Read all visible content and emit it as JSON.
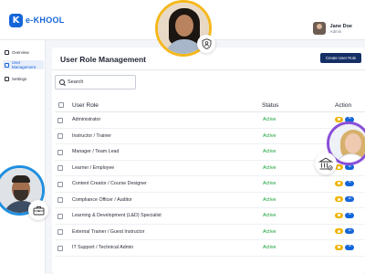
{
  "brand": {
    "logo_mark": "K",
    "name": "e-KHOOL",
    "color": "#1466d8"
  },
  "user": {
    "name": "Jane Doe",
    "role": "Admin"
  },
  "sidebar": {
    "items": [
      {
        "label": "Overview",
        "icon": "overview-icon",
        "active": false
      },
      {
        "label": "User Management",
        "icon": "users-icon",
        "active": true
      },
      {
        "label": "Settings",
        "icon": "settings-icon",
        "active": false
      }
    ]
  },
  "page": {
    "title": "User Role Management",
    "create_button": "Create User Role"
  },
  "search": {
    "placeholder": "Search"
  },
  "table": {
    "columns": [
      "User Role",
      "Status",
      "Action"
    ],
    "rows": [
      {
        "role": "Administrator",
        "status": "Active"
      },
      {
        "role": "Instructor / Trainer",
        "status": "Active"
      },
      {
        "role": "Manager / Team Lead",
        "status": "Active"
      },
      {
        "role": "Learner / Employee",
        "status": "Active"
      },
      {
        "role": "Content Creator / Course Designer",
        "status": "Active"
      },
      {
        "role": "Compliance Officer / Auditor",
        "status": "Active"
      },
      {
        "role": "Learning & Development (L&D) Specialist",
        "status": "Active"
      },
      {
        "role": "External Trainer / Guest Instructor",
        "status": "Active"
      },
      {
        "role": "IT Support / Technical Admin",
        "status": "Active"
      }
    ]
  },
  "colors": {
    "status_active": "#18a23a",
    "primary_button": "#152f66",
    "edit_action": "#f0b400",
    "more_action": "#1466d8"
  },
  "decorations": {
    "icons": [
      "shield-user-icon",
      "bank-icon",
      "briefcase-icon"
    ]
  }
}
